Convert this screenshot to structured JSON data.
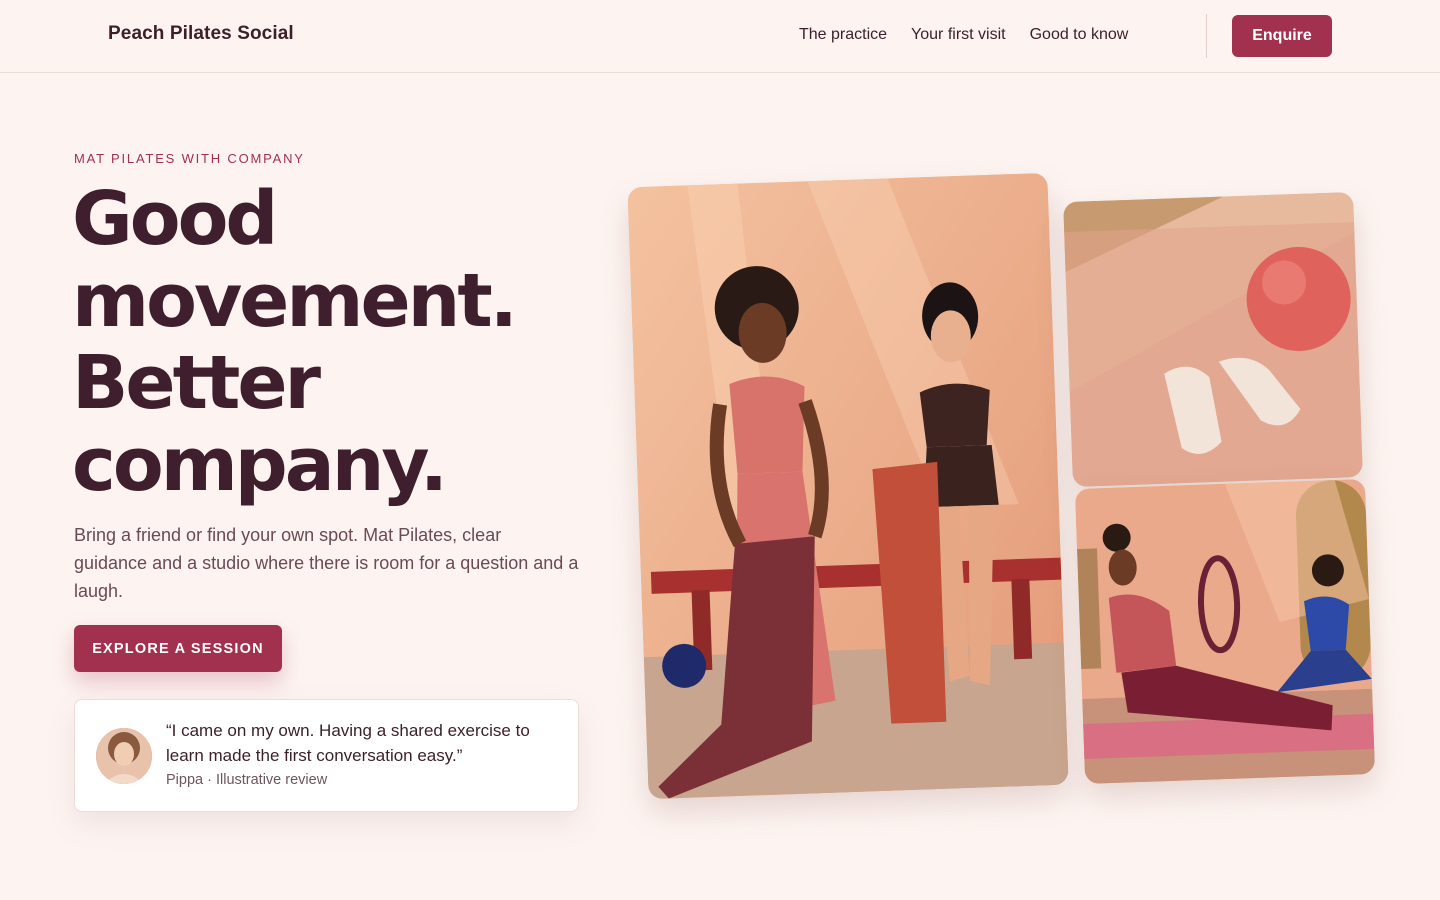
{
  "brand": {
    "name": "Peach Pilates Social"
  },
  "nav": {
    "items": [
      "The practice",
      "Your first visit",
      "Good to know"
    ],
    "cta": "Enquire"
  },
  "hero": {
    "eyebrow": "MAT PILATES WITH COMPANY",
    "headline": [
      "Good",
      "movement.",
      "Better",
      "company."
    ],
    "subcopy": "Bring a friend or find your own spot. Mat Pilates, clear guidance and a studio where there is room for a question and a laugh.",
    "cta": "EXPLORE A SESSION"
  },
  "review": {
    "quote": "“I came on my own. Having a shared exercise to learn made the first conversation easy.”",
    "attribution": "Pippa · Illustrative review"
  },
  "colors": {
    "background": "#fdf4f1",
    "accent": "#a2304f",
    "text": "#3b1f2b"
  }
}
